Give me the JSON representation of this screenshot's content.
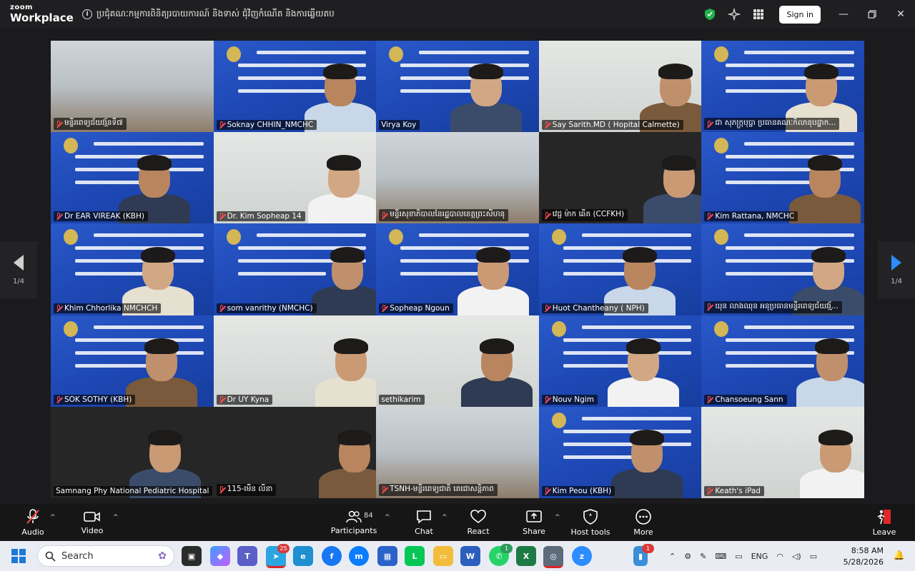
{
  "app": {
    "logo_top": "zoom",
    "logo_bottom": "Workplace"
  },
  "meeting_title": "ប្រជុំគណៈកម្មការពិនិត្យរបាយការណ៍ និងទាស់ ជុំវិញកំណើត និងការឆ្លើយតប",
  "titlebar": {
    "signin_label": "Sign in"
  },
  "pager": {
    "left_label": "1/4",
    "right_label": "1/4"
  },
  "participants": [
    {
      "name": "មន្ទីរពេទ្យជ័យវរ្ម័នទី៧",
      "muted": true,
      "scene": "room"
    },
    {
      "name": "Soknay CHHIN_NMCHC",
      "muted": true,
      "scene": "banner"
    },
    {
      "name": "Virya Koy",
      "muted": false,
      "scene": "banner",
      "active": true
    },
    {
      "name": "Say Sarith.MD ( Hopital Calmette)",
      "muted": true,
      "scene": "grey"
    },
    {
      "name": "ជា សុភក្រ្កបុប្ផា ប្រធានគណៈកិលានុបដ្ឋាក...",
      "muted": true,
      "scene": "banner"
    },
    {
      "name": "Dr EAR VIREAK (KBH)",
      "muted": true,
      "scene": "banner"
    },
    {
      "name": "Dr. Kim Sopheap 14",
      "muted": true,
      "scene": "grey"
    },
    {
      "name": "មន្ទីរសុខាភិបាលនៃរដ្ឋបាលខេត្តព្រះសីហនុ",
      "muted": true,
      "scene": "room"
    },
    {
      "name": "វេជ្ជ ម៉ាក ឆើត (CCFKH)",
      "muted": true,
      "scene": "black"
    },
    {
      "name": "Kim Rattana, NMCHC",
      "muted": true,
      "scene": "banner"
    },
    {
      "name": "Khim Chhorlika NMCHCH",
      "muted": true,
      "scene": "banner"
    },
    {
      "name": "som vanrithy (NMCHC)",
      "muted": true,
      "scene": "banner"
    },
    {
      "name": "Sopheap Ngoun",
      "muted": true,
      "scene": "banner"
    },
    {
      "name": "Huot Chantheany ( NPH)",
      "muted": true,
      "scene": "banner"
    },
    {
      "name": "ឃុន លាងឈុន អនុប្រធានមន្ទីរពេទ្យជ័យវរ្ម័...",
      "muted": true,
      "scene": "banner"
    },
    {
      "name": "SOK SOTHY (KBH)",
      "muted": true,
      "scene": "banner"
    },
    {
      "name": "Dr UY Kyna",
      "muted": true,
      "scene": "grey"
    },
    {
      "name": "sethikarim",
      "muted": false,
      "scene": "grey"
    },
    {
      "name": "Nouv Ngim",
      "muted": true,
      "scene": "banner"
    },
    {
      "name": "Chansoeung Sann",
      "muted": true,
      "scene": "banner"
    },
    {
      "name": "Samnang Phy National Pediatric Hospital",
      "muted": false,
      "scene": "black"
    },
    {
      "name": "115-មើន លីនា",
      "muted": true,
      "scene": "black"
    },
    {
      "name": "TSNH-មន្ទីរពេទ្យជាតិ តេជោសន្តិភាព",
      "muted": true,
      "scene": "room"
    },
    {
      "name": "Kim Peou (KBH)",
      "muted": true,
      "scene": "banner"
    },
    {
      "name": "Keath's iPad",
      "muted": true,
      "scene": "grey"
    }
  ],
  "toolbar": {
    "audio": "Audio",
    "video": "Video",
    "participants": "Participants",
    "participants_count": "84",
    "chat": "Chat",
    "react": "React",
    "share": "Share",
    "host_tools": "Host tools",
    "more": "More",
    "leave": "Leave"
  },
  "taskbar": {
    "search_placeholder": "Search",
    "telegram_badge": "25",
    "whatsapp_badge": "1",
    "notification_badge": "1",
    "language": "ENG",
    "time": "8:58 AM",
    "date": "5/28/2026"
  },
  "colors": {
    "accent_blue": "#2d8cff",
    "active_speaker": "#2fd39a",
    "muted_red": "#ff4a4a"
  }
}
